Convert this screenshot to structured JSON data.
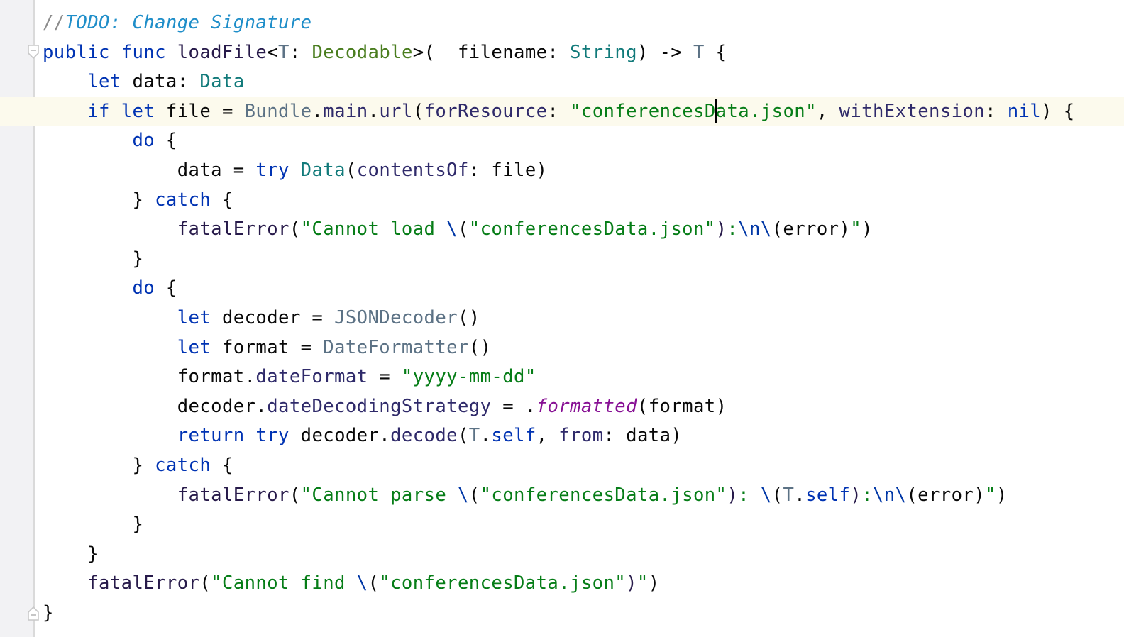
{
  "editor": {
    "language": "swift",
    "caret": {
      "line": 4,
      "after_text": "conferencesD"
    },
    "lines": [
      {
        "n": 1,
        "indent": 0,
        "tokens": [
          {
            "t": "//",
            "c": "cm"
          },
          {
            "t": "TODO: Change Signature",
            "c": "td"
          }
        ]
      },
      {
        "n": 2,
        "indent": 0,
        "fold": "open",
        "tokens": [
          {
            "t": "public",
            "c": "kw"
          },
          {
            "t": " "
          },
          {
            "t": "func",
            "c": "kw"
          },
          {
            "t": " "
          },
          {
            "t": "loadFile",
            "c": "fn"
          },
          {
            "t": "<"
          },
          {
            "t": "T",
            "c": "tp"
          },
          {
            "t": ": "
          },
          {
            "t": "Decodable",
            "c": "pr"
          },
          {
            "t": ">(_ filename: "
          },
          {
            "t": "String",
            "c": "ty"
          },
          {
            "t": ") -> "
          },
          {
            "t": "T",
            "c": "tp"
          },
          {
            "t": " {"
          }
        ]
      },
      {
        "n": 3,
        "indent": 1,
        "tokens": [
          {
            "t": "let",
            "c": "kw"
          },
          {
            "t": " data: "
          },
          {
            "t": "Data",
            "c": "ty"
          }
        ]
      },
      {
        "n": 4,
        "indent": 1,
        "current": true,
        "tokens": [
          {
            "t": "if",
            "c": "kw"
          },
          {
            "t": " "
          },
          {
            "t": "let",
            "c": "kw"
          },
          {
            "t": " file = "
          },
          {
            "t": "Bundle",
            "c": "lib"
          },
          {
            "t": "."
          },
          {
            "t": "main",
            "c": "mt"
          },
          {
            "t": "."
          },
          {
            "t": "url",
            "c": "mt"
          },
          {
            "t": "("
          },
          {
            "t": "forResource",
            "c": "mt"
          },
          {
            "t": ": "
          },
          {
            "t": "\"conferencesD",
            "c": "st"
          },
          {
            "t": "",
            "caret": true
          },
          {
            "t": "ata.json\"",
            "c": "st"
          },
          {
            "t": ", "
          },
          {
            "t": "withExtension",
            "c": "mt"
          },
          {
            "t": ": "
          },
          {
            "t": "nil",
            "c": "kw"
          },
          {
            "t": ") {"
          }
        ]
      },
      {
        "n": 5,
        "indent": 2,
        "tokens": [
          {
            "t": "do",
            "c": "kw"
          },
          {
            "t": " {"
          }
        ]
      },
      {
        "n": 6,
        "indent": 3,
        "tokens": [
          {
            "t": "data = "
          },
          {
            "t": "try",
            "c": "kw"
          },
          {
            "t": " "
          },
          {
            "t": "Data",
            "c": "ty"
          },
          {
            "t": "("
          },
          {
            "t": "contentsOf",
            "c": "mt"
          },
          {
            "t": ": file)"
          }
        ]
      },
      {
        "n": 7,
        "indent": 2,
        "tokens": [
          {
            "t": "} "
          },
          {
            "t": "catch",
            "c": "kw"
          },
          {
            "t": " {"
          }
        ]
      },
      {
        "n": 8,
        "indent": 3,
        "tokens": [
          {
            "t": "fatalError",
            "c": "fn"
          },
          {
            "t": "("
          },
          {
            "t": "\"Cannot load ",
            "c": "st"
          },
          {
            "t": "\\",
            "c": "es"
          },
          {
            "t": "("
          },
          {
            "t": "\"conferencesData.json\"",
            "c": "st"
          },
          {
            "t": ")",
            "c": "fn"
          },
          {
            "t": ":",
            "c": "st"
          },
          {
            "t": "\\n",
            "c": "es"
          },
          {
            "t": "\\",
            "c": "es"
          },
          {
            "t": "(error)"
          },
          {
            "t": "\"",
            "c": "st"
          },
          {
            "t": ")"
          }
        ]
      },
      {
        "n": 9,
        "indent": 2,
        "tokens": [
          {
            "t": "}"
          }
        ]
      },
      {
        "n": 10,
        "indent": 2,
        "tokens": [
          {
            "t": "do",
            "c": "kw"
          },
          {
            "t": " {"
          }
        ]
      },
      {
        "n": 11,
        "indent": 3,
        "tokens": [
          {
            "t": "let",
            "c": "kw"
          },
          {
            "t": " decoder = "
          },
          {
            "t": "JSONDecoder",
            "c": "lib"
          },
          {
            "t": "()"
          }
        ]
      },
      {
        "n": 12,
        "indent": 3,
        "tokens": [
          {
            "t": "let",
            "c": "kw"
          },
          {
            "t": " format = "
          },
          {
            "t": "DateFormatter",
            "c": "lib"
          },
          {
            "t": "()"
          }
        ]
      },
      {
        "n": 13,
        "indent": 3,
        "tokens": [
          {
            "t": "format."
          },
          {
            "t": "dateFormat",
            "c": "mt"
          },
          {
            "t": " = "
          },
          {
            "t": "\"yyyy-mm-dd\"",
            "c": "st"
          }
        ]
      },
      {
        "n": 14,
        "indent": 3,
        "tokens": [
          {
            "t": "decoder."
          },
          {
            "t": "dateDecodingStrategy",
            "c": "mt"
          },
          {
            "t": " = ."
          },
          {
            "t": "formatted",
            "c": "enm"
          },
          {
            "t": "(format)"
          }
        ]
      },
      {
        "n": 15,
        "indent": 3,
        "tokens": [
          {
            "t": "return",
            "c": "kw"
          },
          {
            "t": " "
          },
          {
            "t": "try",
            "c": "kw"
          },
          {
            "t": " decoder."
          },
          {
            "t": "decode",
            "c": "mt"
          },
          {
            "t": "("
          },
          {
            "t": "T",
            "c": "tp"
          },
          {
            "t": "."
          },
          {
            "t": "self",
            "c": "kw"
          },
          {
            "t": ", "
          },
          {
            "t": "from",
            "c": "mt"
          },
          {
            "t": ": data)"
          }
        ]
      },
      {
        "n": 16,
        "indent": 2,
        "tokens": [
          {
            "t": "} "
          },
          {
            "t": "catch",
            "c": "kw"
          },
          {
            "t": " {"
          }
        ]
      },
      {
        "n": 17,
        "indent": 3,
        "tokens": [
          {
            "t": "fatalError",
            "c": "fn"
          },
          {
            "t": "("
          },
          {
            "t": "\"Cannot parse ",
            "c": "st"
          },
          {
            "t": "\\",
            "c": "es"
          },
          {
            "t": "("
          },
          {
            "t": "\"conferencesData.json\"",
            "c": "st"
          },
          {
            "t": ")",
            "c": "fn"
          },
          {
            "t": ": ",
            "c": "st"
          },
          {
            "t": "\\",
            "c": "es"
          },
          {
            "t": "("
          },
          {
            "t": "T",
            "c": "tp"
          },
          {
            "t": "."
          },
          {
            "t": "self",
            "c": "kw"
          },
          {
            "t": ")",
            "c": "fn"
          },
          {
            "t": ":",
            "c": "st"
          },
          {
            "t": "\\n",
            "c": "es"
          },
          {
            "t": "\\",
            "c": "es"
          },
          {
            "t": "(error)"
          },
          {
            "t": "\"",
            "c": "st"
          },
          {
            "t": ")"
          }
        ]
      },
      {
        "n": 18,
        "indent": 2,
        "tokens": [
          {
            "t": "}"
          }
        ]
      },
      {
        "n": 19,
        "indent": 1,
        "tokens": [
          {
            "t": "}"
          }
        ]
      },
      {
        "n": 20,
        "indent": 1,
        "tokens": [
          {
            "t": "fatalError",
            "c": "fn"
          },
          {
            "t": "("
          },
          {
            "t": "\"Cannot find ",
            "c": "st"
          },
          {
            "t": "\\",
            "c": "es"
          },
          {
            "t": "("
          },
          {
            "t": "\"conferencesData.json\"",
            "c": "st"
          },
          {
            "t": ")",
            "c": "fn"
          },
          {
            "t": "\"",
            "c": "st"
          },
          {
            "t": ")"
          }
        ]
      },
      {
        "n": 21,
        "indent": 0,
        "fold": "close",
        "tokens": [
          {
            "t": "}"
          }
        ]
      }
    ]
  },
  "icons": {
    "fold_open": "fold-collapse-icon",
    "fold_close": "fold-end-icon"
  }
}
